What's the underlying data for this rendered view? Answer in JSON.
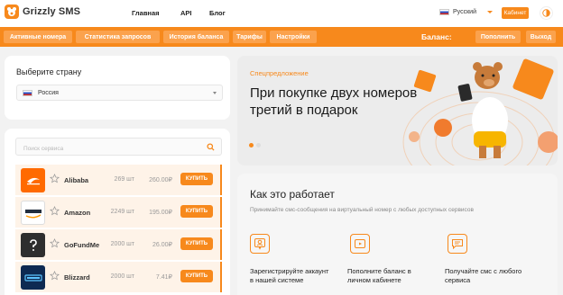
{
  "header": {
    "logo_text": "Grizzly SMS",
    "nav": [
      "Главная",
      "API",
      "Блог"
    ],
    "language": "Русский",
    "cabinet_label": "Кабинет"
  },
  "toolbar": {
    "tabs": [
      "Активные номера",
      "Статистика запросов",
      "История баланса",
      "Тарифы",
      "Настройки"
    ],
    "balance_label": "Баланс:",
    "balance_value": "",
    "topup_label": "Пополнить",
    "logout_label": "Выход"
  },
  "country": {
    "title": "Выберите страну",
    "selected": "Россия"
  },
  "search": {
    "placeholder": "Поиск сервиса"
  },
  "services": [
    {
      "name": "Alibaba",
      "count": "269 шт",
      "price": "260.00₽",
      "buy": "КУПИТЬ",
      "logo": "alibaba-logo",
      "logo_color": "#ff6a00"
    },
    {
      "name": "Amazon",
      "count": "2249 шт",
      "price": "195.00₽",
      "buy": "КУПИТЬ",
      "logo": "amazon-logo",
      "logo_color": "#232f3e"
    },
    {
      "name": "GoFundMe",
      "count": "2000 шт",
      "price": "26.00₽",
      "buy": "КУПИТЬ",
      "logo": "question-icon",
      "logo_color": "#333333"
    },
    {
      "name": "Blizzard",
      "count": "2000 шт",
      "price": "7.41₽",
      "buy": "КУПИТЬ",
      "logo": "blizzard-logo",
      "logo_color": "#0e2a52"
    }
  ],
  "promo": {
    "tag": "Спецпредложение",
    "title": "При покупке двух номеров третий в подарок"
  },
  "how": {
    "title": "Как это работает",
    "subtitle": "Принимайте смс-сообщения на виртуальный номер с любых доступных сервисов",
    "steps": [
      {
        "text": "Зарегистрируйте аккаунт в нашей системе",
        "icon": "user-icon"
      },
      {
        "text": "Пополните баланс в личном кабинете",
        "icon": "wallet-icon"
      },
      {
        "text": "Получайте смс с любого сервиса",
        "icon": "message-icon"
      }
    ]
  },
  "colors": {
    "accent": "#f7891c",
    "accent_light": "#fba24d"
  }
}
